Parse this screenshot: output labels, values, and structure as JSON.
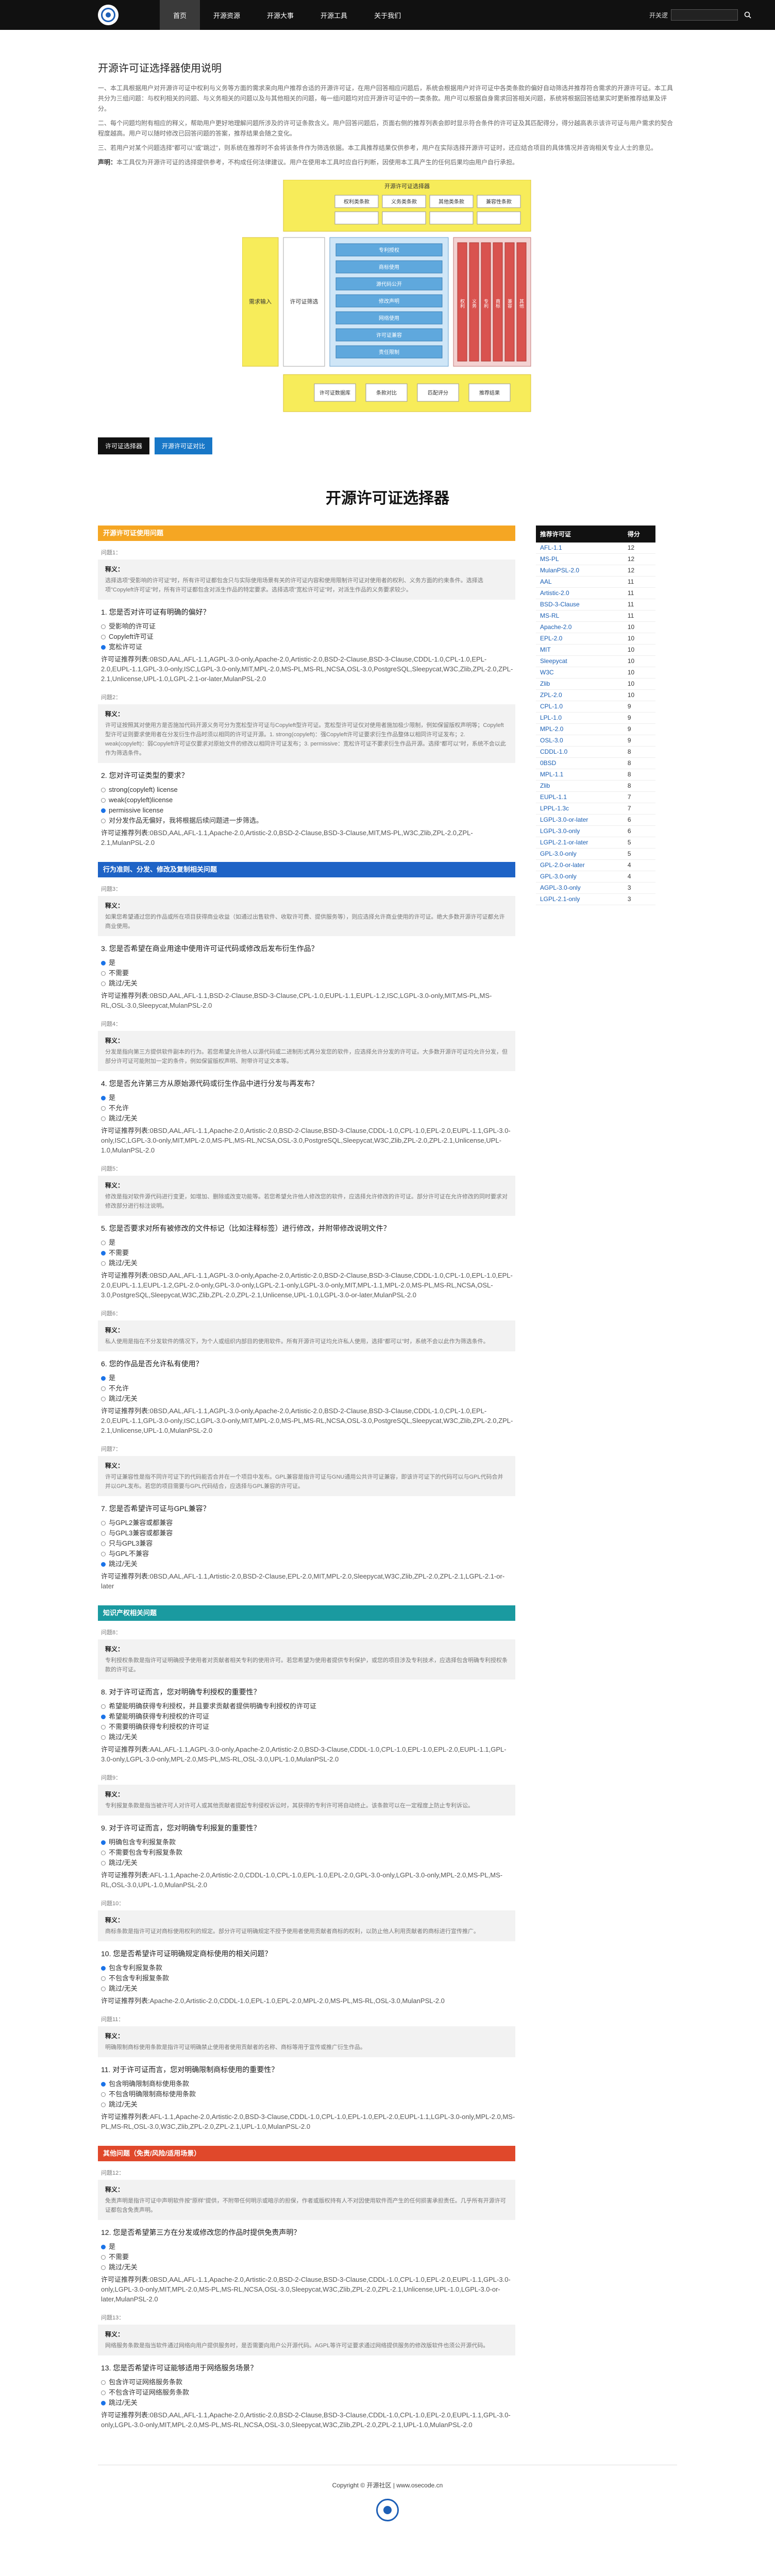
{
  "nav": {
    "items": [
      "首页",
      "开源资源",
      "开源大事",
      "开源工具",
      "关于我们"
    ],
    "search_label": "开关逻",
    "search_placeholder": "",
    "search_icon": "search-icon"
  },
  "page": {
    "title": "开源许可证选择器使用说明",
    "intro": [
      "一、本工具根据用户对开源许可证中权利与义务等方面的需求来向用户推荐合适的开源许可证，在用户回答相应问题后，系统会根据用户对许可证中各类条款的偏好自动筛选并推荐符合需求的开源许可证。本工具共分为三组问题：与权利相关的问题、与义务相关的问题以及与其他相关的问题，每一组问题均对应开源许可证中的一类条款。用户可以根据自身需求回答相关问题，系统将根据回答结果实时更新推荐结果及评分。",
      "二、每个问题均附有相应的释义，帮助用户更好地理解问题所涉及的许可证条款含义。用户回答问题后，页面右侧的推荐列表会即时显示符合条件的许可证及其匹配得分，得分越高表示该许可证与用户需求的契合程度越高。用户可以随时修改已回答问题的答案，推荐结果会随之变化。",
      "三、若用户对某个问题选择\"都可以\"或\"跳过\"，则系统在推荐时不会将该条件作为筛选依据。本工具推荐结果仅供参考，用户在实际选择开源许可证时，还应结合项目的具体情况并咨询相关专业人士的意见。"
    ],
    "intro_note_label": "声明：",
    "intro_note": "本工具仅为开源许可证的选择提供参考，不构成任何法律建议。用户在使用本工具时应自行判断，因使用本工具产生的任何后果均由用户自行承担。"
  },
  "diagram": {
    "top_label": "开源许可证选择器",
    "left_label": "需求输入",
    "mid_label": "许可证筛选",
    "top_boxes": [
      "权利类条款",
      "义务类条款",
      "其他类条款",
      "兼容性条款"
    ],
    "mid_rows": [
      "专利授权",
      "商标使用",
      "源代码公开",
      "修改声明",
      "网络使用",
      "许可证兼容",
      "责任限制"
    ],
    "right_cols": [
      "权利",
      "义务",
      "专利",
      "商标",
      "兼容",
      "其他"
    ],
    "bottom_boxes": [
      "许可证数据库",
      "条款对比",
      "匹配评分",
      "推荐结果"
    ]
  },
  "tabs": [
    "许可证选择器",
    "开源许可证对比"
  ],
  "heading": "开源许可证选择器",
  "sections": [
    {
      "title": "开源许可证使用问题",
      "color": "#f5a623",
      "questions": [
        {
          "tag": "问题1：",
          "note_title": "释义：",
          "note": "选择选项\"受影响的许可证\"时，所有许可证都包含只与实际使用场景有关的许可证内容和使用限制许可证对使用者的权利、义务方面的约束条件。选择选项\"Copyleft许可证\"时，所有许可证都包含对派生作品的特定要求。选择选项\"宽松许可证\"时，对派生作品的义务要求较少。",
          "title": "1. 您是否对许可证有明确的偏好？",
          "options": [
            "受影响的许可证",
            "Copyleft许可证",
            "宽松许可证"
          ],
          "selected": 2,
          "result_label": "许可证推荐列表:",
          "result": "0BSD,AAL,AFL-1.1,AGPL-3.0-only,Apache-2.0,Artistic-2.0,BSD-2-Clause,BSD-3-Clause,CDDL-1.0,CPL-1.0,EPL-2.0,EUPL-1.1,GPL-3.0-only,ISC,LGPL-3.0-only,MIT,MPL-2.0,MS-PL,MS-RL,NCSA,OSL-3.0,PostgreSQL,Sleepycat,W3C,Zlib,ZPL-2.0,ZPL-2.1,Unlicense,UPL-1.0,LGPL-2.1-or-later,MulanPSL-2.0"
        },
        {
          "tag": "问题2：",
          "note_title": "释义：",
          "note": "许可证按照其对使用方是否施加代码开源义务可分为宽松型许可证与Copyleft型许可证。宽松型许可证仅对使用者施加极少限制，例如保留版权声明等；Copyleft型许可证则要求使用者在分发衍生作品时须以相同的许可证开源。1. strong(copyleft)：强Copyleft许可证要求衍生作品整体以相同许可证发布；2. weak(copyleft)：弱Copyleft许可证仅要求对原始文件的修改以相同许可证发布；3. permissive：宽松许可证不要求衍生作品开源。选择\"都可以\"时，系统不会以此作为筛选条件。",
          "title": "2. 您对许可证类型的要求？",
          "options": [
            "strong(copyleft) license",
            "weak(copyleft)license",
            "permissive license",
            "对分发作品无偏好，我将根据后续问题进一步筛选。"
          ],
          "selected": 2,
          "result_label": "许可证推荐列表:",
          "result": "0BSD,AAL,AFL-1.1,Apache-2.0,Artistic-2.0,BSD-2-Clause,BSD-3-Clause,MIT,MS-PL,W3C,Zlib,ZPL-2.0,ZPL-2.1,MulanPSL-2.0"
        }
      ]
    },
    {
      "title": "行为准则、分发、修改及复制相关问题",
      "color": "#1e63c6",
      "questions": [
        {
          "tag": "问题3：",
          "note_title": "释义：",
          "note": "如果您希望通过您的作品或所在项目获得商业收益（如通过出售软件、收取许可费、提供服务等），则应选择允许商业使用的许可证。绝大多数开源许可证都允许商业使用。",
          "title": "3. 您是否希望在商业用途中使用许可证代码或修改后发布衍生作品？",
          "options": [
            "是",
            "不需要",
            "跳过/无关"
          ],
          "selected": 0,
          "result_label": "许可证推荐列表:",
          "result": "0BSD,AAL,AFL-1.1,BSD-2-Clause,BSD-3-Clause,CPL-1.0,EUPL-1.1,EUPL-1.2,ISC,LGPL-3.0-only,MIT,MS-PL,MS-RL,OSL-3.0,Sleepycat,MulanPSL-2.0"
        },
        {
          "tag": "问题4：",
          "note_title": "释义：",
          "note": "分发是指向第三方提供软件副本的行为。若您希望允许他人以源代码或二进制形式再分发您的软件，应选择允许分发的许可证。大多数开源许可证均允许分发，但部分许可证可能附加一定的条件，例如保留版权声明、附带许可证文本等。",
          "title": "4. 您是否允许第三方从原始源代码或衍生作品中进行分发与再发布？",
          "options": [
            "是",
            "不允许",
            "跳过/无关"
          ],
          "selected": 0,
          "result_label": "许可证推荐列表:",
          "result": "0BSD,AAL,AFL-1.1,Apache-2.0,Artistic-2.0,BSD-2-Clause,BSD-3-Clause,CDDL-1.0,CPL-1.0,EPL-2.0,EUPL-1.1,GPL-3.0-only,ISC,LGPL-3.0-only,MIT,MPL-2.0,MS-PL,MS-RL,NCSA,OSL-3.0,PostgreSQL,Sleepycat,W3C,Zlib,ZPL-2.0,ZPL-2.1,Unlicense,UPL-1.0,MulanPSL-2.0"
        },
        {
          "tag": "问题5：",
          "note_title": "释义：",
          "note": "修改是指对软件源代码进行变更，如增加、删除或改变功能等。若您希望允许他人修改您的软件，应选择允许修改的许可证。部分许可证在允许修改的同时要求对修改部分进行标注说明。",
          "title": "5. 您是否要求对所有被修改的文件标记（比如注释标签）进行修改，并附带修改说明文件？",
          "options": [
            "是",
            "不需要",
            "跳过/无关"
          ],
          "selected": 1,
          "result_label": "许可证推荐列表:",
          "result": "0BSD,AAL,AFL-1.1,AGPL-3.0-only,Apache-2.0,Artistic-2.0,BSD-2-Clause,BSD-3-Clause,CDDL-1.0,CPL-1.0,EPL-1.0,EPL-2.0,EUPL-1.1,EUPL-1.2,GPL-2.0-only,GPL-3.0-only,LGPL-2.1-only,LGPL-3.0-only,MIT,MPL-1.1,MPL-2.0,MS-PL,MS-RL,NCSA,OSL-3.0,PostgreSQL,Sleepycat,W3C,Zlib,ZPL-2.0,ZPL-2.1,Unlicense,UPL-1.0,LGPL-3.0-or-later,MulanPSL-2.0"
        },
        {
          "tag": "问题6：",
          "note_title": "释义：",
          "note": "私人使用是指在不分发软件的情况下，为个人或组织内部目的使用软件。所有开源许可证均允许私人使用，选择\"都可以\"时，系统不会以此作为筛选条件。",
          "title": "6. 您的作品是否允许私有使用？",
          "options": [
            "是",
            "不允许",
            "跳过/无关"
          ],
          "selected": 0,
          "result_label": "许可证推荐列表:",
          "result": "0BSD,AAL,AFL-1.1,AGPL-3.0-only,Apache-2.0,Artistic-2.0,BSD-2-Clause,BSD-3-Clause,CDDL-1.0,CPL-1.0,EPL-2.0,EUPL-1.1,GPL-3.0-only,ISC,LGPL-3.0-only,MIT,MPL-2.0,MS-PL,MS-RL,NCSA,OSL-3.0,PostgreSQL,Sleepycat,W3C,Zlib,ZPL-2.0,ZPL-2.1,Unlicense,UPL-1.0,MulanPSL-2.0"
        },
        {
          "tag": "问题7：",
          "note_title": "释义：",
          "note": "许可证兼容性是指不同许可证下的代码能否合并在一个项目中发布。GPL兼容是指许可证与GNU通用公共许可证兼容，即该许可证下的代码可以与GPL代码合并并以GPL发布。若您的项目需要与GPL代码结合，应选择与GPL兼容的许可证。",
          "title": "7. 您是否希望许可证与GPL兼容？",
          "options": [
            "与GPL2兼容或都兼容",
            "与GPL3兼容或都兼容",
            "只与GPL3兼容",
            "与GPL不兼容",
            "跳过/无关"
          ],
          "selected": 4,
          "result_label": "许可证推荐列表:",
          "result": "0BSD,AAL,AFL-1.1,Artistic-2.0,BSD-2-Clause,EPL-2.0,MIT,MPL-2.0,Sleepycat,W3C,Zlib,ZPL-2.0,ZPL-2.1,LGPL-2.1-or-later"
        }
      ]
    },
    {
      "title": "知识产权相关问题",
      "color": "#1a9aa0",
      "questions": [
        {
          "tag": "问题8：",
          "note_title": "释义：",
          "note": "专利授权条款是指许可证明确授予使用者对贡献者相关专利的使用许可。若您希望为使用者提供专利保护，或您的项目涉及专利技术，应选择包含明确专利授权条款的许可证。",
          "title": "8. 对于许可证而言，您对明确专利授权的重要性？",
          "options": [
            "希望能明确获得专利授权，并且要求贡献者提供明确专利授权的许可证",
            "希望能明确获得专利授权的许可证",
            "不需要明确获得专利授权的许可证",
            "跳过/无关"
          ],
          "selected": 1,
          "result_label": "许可证推荐列表:",
          "result": "AAL,AFL-1.1,AGPL-3.0-only,Apache-2.0,Artistic-2.0,BSD-3-Clause,CDDL-1.0,CPL-1.0,EPL-1.0,EPL-2.0,EUPL-1.1,GPL-3.0-only,LGPL-3.0-only,MPL-2.0,MS-PL,MS-RL,OSL-3.0,UPL-1.0,MulanPSL-2.0"
        },
        {
          "tag": "问题9：",
          "note_title": "释义：",
          "note": "专利报复条款是指当被许可人对许可人或其他贡献者提起专利侵权诉讼时，其获得的专利许可将自动终止。该条款可以在一定程度上防止专利诉讼。",
          "title": "9. 对于许可证而言，您对明确专利报复的重要性？",
          "options": [
            "明确包含专利报复条款",
            "不需要包含专利报复条款",
            "跳过/无关"
          ],
          "selected": 0,
          "result_label": "许可证推荐列表:",
          "result": "AFL-1.1,Apache-2.0,Artistic-2.0,CDDL-1.0,CPL-1.0,EPL-1.0,EPL-2.0,GPL-3.0-only,LGPL-3.0-only,MPL-2.0,MS-PL,MS-RL,OSL-3.0,UPL-1.0,MulanPSL-2.0"
        },
        {
          "tag": "问题10：",
          "note_title": "释义：",
          "note": "商标条款是指许可证对商标使用权利的规定。部分许可证明确规定不授予使用者使用贡献者商标的权利，以防止他人利用贡献者的商标进行宣传推广。",
          "title": "10. 您是否希望许可证明确规定商标使用的相关问题？",
          "options": [
            "包含专利报复条款",
            "不包含专利报复条款",
            "跳过/无关"
          ],
          "selected": 0,
          "result_label": "许可证推荐列表:",
          "result": "Apache-2.0,Artistic-2.0,CDDL-1.0,EPL-1.0,EPL-2.0,MPL-2.0,MS-PL,MS-RL,OSL-3.0,MulanPSL-2.0"
        },
        {
          "tag": "问题11：",
          "note_title": "释义：",
          "note": "明确限制商标使用条款是指许可证明确禁止使用者使用贡献者的名称、商标等用于宣传或推广衍生作品。",
          "title": "11. 对于许可证而言，您对明确限制商标使用的重要性？",
          "options": [
            "包含明确限制商标使用条款",
            "不包含明确限制商标使用条款",
            "跳过/无关"
          ],
          "selected": 0,
          "result_label": "许可证推荐列表:",
          "result": "AFL-1.1,Apache-2.0,Artistic-2.0,BSD-3-Clause,CDDL-1.0,CPL-1.0,EPL-1.0,EPL-2.0,EUPL-1.1,LGPL-3.0-only,MPL-2.0,MS-PL,MS-RL,OSL-3.0,W3C,Zlib,ZPL-2.0,ZPL-2.1,UPL-1.0,MulanPSL-2.0"
        }
      ]
    },
    {
      "title": "其他问题（免责/风险/适用场景）",
      "color": "#e0482b",
      "questions": [
        {
          "tag": "问题12：",
          "note_title": "释义：",
          "note": "免责声明是指许可证中声明软件按\"原样\"提供，不附带任何明示或暗示的担保，作者或版权持有人不对因使用软件而产生的任何损害承担责任。几乎所有开源许可证都包含免责声明。",
          "title": "12. 您是否希望第三方在分发或修改您的作品时提供免责声明？",
          "options": [
            "是",
            "不需要",
            "跳过/无关"
          ],
          "selected": 0,
          "result_label": "许可证推荐列表:",
          "result": "0BSD,AAL,AFL-1.1,Apache-2.0,Artistic-2.0,BSD-2-Clause,BSD-3-Clause,CDDL-1.0,CPL-1.0,EPL-2.0,EUPL-1.1,GPL-3.0-only,LGPL-3.0-only,MIT,MPL-2.0,MS-PL,MS-RL,NCSA,OSL-3.0,Sleepycat,W3C,Zlib,ZPL-2.0,ZPL-2.1,Unlicense,UPL-1.0,LGPL-3.0-or-later,MulanPSL-2.0"
        },
        {
          "tag": "问题13：",
          "note_title": "释义：",
          "note": "网络服务条款是指当软件通过网络向用户提供服务时，是否需要向用户公开源代码。AGPL等许可证要求通过网络提供服务的修改版软件也须公开源代码。",
          "title": "13. 您是否希望许可证能够适用于网络服务场景？",
          "options": [
            "包含许可证网络服务条款",
            "不包含许可证网络服务条款",
            "跳过/无关"
          ],
          "selected": 2,
          "result_label": "许可证推荐列表:",
          "result": "0BSD,AAL,AFL-1.1,Apache-2.0,Artistic-2.0,BSD-2-Clause,BSD-3-Clause,CDDL-1.0,CPL-1.0,EPL-2.0,EUPL-1.1,GPL-3.0-only,LGPL-3.0-only,MIT,MPL-2.0,MS-PL,MS-RL,NCSA,OSL-3.0,Sleepycat,W3C,Zlib,ZPL-2.0,ZPL-2.1,UPL-1.0,MulanPSL-2.0"
        }
      ]
    }
  ],
  "sidebar": {
    "col_license": "推荐许可证",
    "col_score": "得分",
    "rows": [
      [
        "AFL-1.1",
        "12"
      ],
      [
        "MS-PL",
        "12"
      ],
      [
        "MulanPSL-2.0",
        "12"
      ],
      [
        "AAL",
        "11"
      ],
      [
        "Artistic-2.0",
        "11"
      ],
      [
        "BSD-3-Clause",
        "11"
      ],
      [
        "MS-RL",
        "11"
      ],
      [
        "Apache-2.0",
        "10"
      ],
      [
        "EPL-2.0",
        "10"
      ],
      [
        "MIT",
        "10"
      ],
      [
        "Sleepycat",
        "10"
      ],
      [
        "W3C",
        "10"
      ],
      [
        "Zlib",
        "10"
      ],
      [
        "ZPL-2.0",
        "10"
      ],
      [
        "CPL-1.0",
        "9"
      ],
      [
        "LPL-1.0",
        "9"
      ],
      [
        "MPL-2.0",
        "9"
      ],
      [
        "OSL-3.0",
        "9"
      ],
      [
        "CDDL-1.0",
        "8"
      ],
      [
        "0BSD",
        "8"
      ],
      [
        "MPL-1.1",
        "8"
      ],
      [
        "Zlib",
        "8"
      ],
      [
        "EUPL-1.1",
        "7"
      ],
      [
        "LPPL-1.3c",
        "7"
      ],
      [
        "LGPL-3.0-or-later",
        "6"
      ],
      [
        "LGPL-3.0-only",
        "6"
      ],
      [
        "LGPL-2.1-or-later",
        "5"
      ],
      [
        "GPL-3.0-only",
        "5"
      ],
      [
        "GPL-2.0-or-later",
        "4"
      ],
      [
        "GPL-3.0-only",
        "4"
      ],
      [
        "AGPL-3.0-only",
        "3"
      ],
      [
        "LGPL-2.1-only",
        "3"
      ]
    ]
  },
  "footer": {
    "copyright": "Copyright © 开源社区 | www.osecode.cn"
  }
}
